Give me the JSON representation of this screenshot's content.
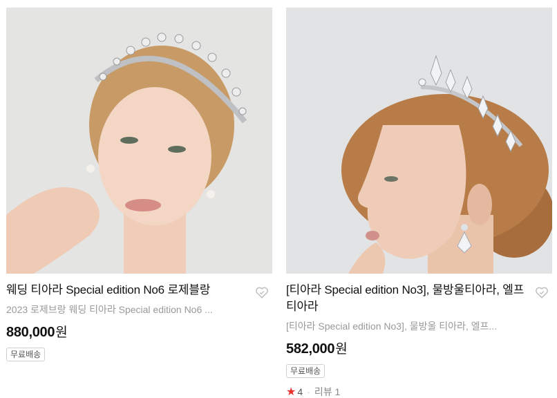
{
  "products": [
    {
      "title": "웨딩 티아라 Special edition No6 로제블랑",
      "subtitle": "2023 로제브랑 웨딩 티아라 Special edition No6 ...",
      "price": "880,000",
      "currency": "원",
      "badge": "무료배송",
      "wishlist_icon": "heart-outline-icon"
    },
    {
      "title": "[티아라 Special edition No3], 물방울티아라, 엘프티아라",
      "subtitle": "[티아라 Special edition No3], 물방울 티아라, 엘프...",
      "price": "582,000",
      "currency": "원",
      "badge": "무료배송",
      "rating": "4",
      "review_label": "리뷰 1",
      "wishlist_icon": "heart-outline-icon"
    }
  ],
  "colors": {
    "star": "#e8302c",
    "price": "#111111",
    "subtitle": "#999999"
  }
}
